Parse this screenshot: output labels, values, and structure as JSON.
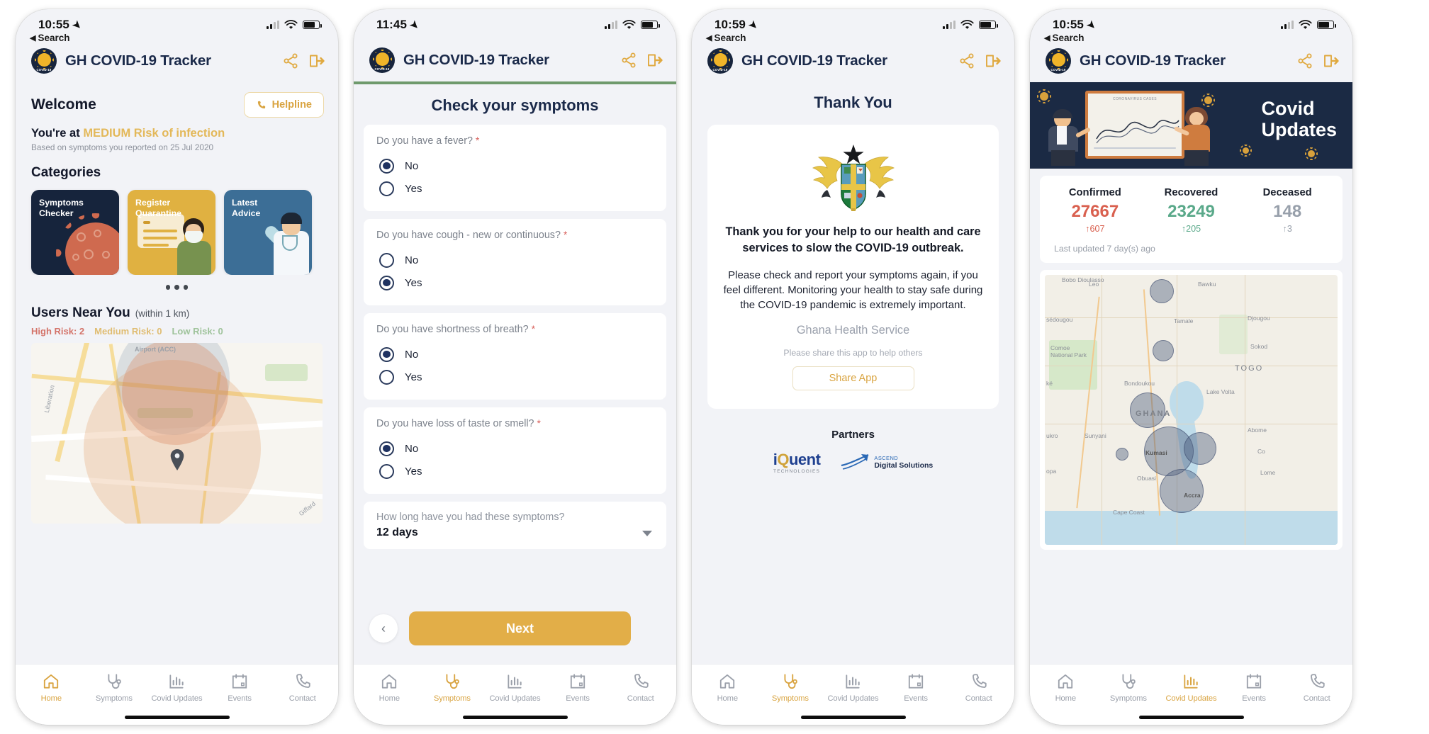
{
  "app": {
    "title": "GH COVID-19 Tracker",
    "back_label": "Search",
    "share_icon": "share-icon",
    "logout_icon": "logout-icon"
  },
  "nav": {
    "items": [
      {
        "label": "Home",
        "icon": "home-icon"
      },
      {
        "label": "Symptoms",
        "icon": "stethoscope-icon"
      },
      {
        "label": "Covid Updates",
        "icon": "bar-chart-icon"
      },
      {
        "label": "Events",
        "icon": "calendar-icon"
      },
      {
        "label": "Contact",
        "icon": "phone-icon"
      }
    ]
  },
  "phone1": {
    "status": {
      "time": "10:55",
      "battery": "78%"
    },
    "welcome_title": "Welcome",
    "helpline_label": "Helpline",
    "risk_prefix": "You're at",
    "risk_value": "MEDIUM Risk of infection",
    "risk_subtitle": "Based on symptoms you reported on 25 Jul 2020",
    "categories_title": "Categories",
    "cards": [
      {
        "line1": "Symptoms",
        "line2": "Checker",
        "theme": "dark"
      },
      {
        "line1": "Register",
        "line2": "Quarantine",
        "theme": "amber"
      },
      {
        "line1": "Latest",
        "line2": "Advice",
        "theme": "blue"
      }
    ],
    "users_title": "Users Near You",
    "users_radius": "(within 1 km)",
    "risk_counts": [
      {
        "label": "High Risk: 2",
        "color": "#d4746a"
      },
      {
        "label": "Medium Risk: 0",
        "color": "#e0bd72"
      },
      {
        "label": "Low Risk: 0",
        "color": "#9fc39b"
      }
    ],
    "map_labels": [
      "Liberation",
      "Airport (ACC)",
      "Giffard"
    ],
    "active_nav": "Home"
  },
  "phone2": {
    "status": {
      "time": "11:45"
    },
    "page_title": "Check your symptoms",
    "required_mark": "*",
    "questions": [
      {
        "text": "Do you have a fever?",
        "options": [
          "No",
          "Yes"
        ],
        "selected": "No"
      },
      {
        "text": "Do you have cough - new or continuous?",
        "options": [
          "No",
          "Yes"
        ],
        "selected": "Yes"
      },
      {
        "text": "Do you have shortness of breath?",
        "options": [
          "No",
          "Yes"
        ],
        "selected": "No"
      },
      {
        "text": "Do you have loss of taste or smell?",
        "options": [
          "No",
          "Yes"
        ],
        "selected": "No"
      }
    ],
    "duration": {
      "label": "How long have you had these symptoms?",
      "value": "12 days"
    },
    "back_label": "‹",
    "next_label": "Next",
    "active_nav": "Symptoms"
  },
  "phone3": {
    "status": {
      "time": "10:59"
    },
    "page_title": "Thank You",
    "emblem": "ghana-coat-of-arms",
    "message_bold": "Thank you for your help to our health and care services to slow the COVID-19 outbreak.",
    "message_body": "Please check and report your symptoms again, if you feel different. Monitoring your health to stay safe during the COVID-19 pandemic is extremely important.",
    "organisation": "Ghana Health Service",
    "share_note": "Please share this app to help others",
    "share_button": "Share App",
    "partners_title": "Partners",
    "partners": [
      {
        "name": "iQuent",
        "sub": "TECHNOLOGIES"
      },
      {
        "name": "ASCEND",
        "sub": "Digital Solutions"
      }
    ],
    "active_nav": "Symptoms"
  },
  "phone4": {
    "status": {
      "time": "10:55"
    },
    "banner_title_line1": "Covid",
    "banner_title_line2": "Updates",
    "banner_caption": "CORONAVIRUS CASES",
    "stats": [
      {
        "label": "Confirmed",
        "value": "27667",
        "delta": "↑607",
        "color": "#d9604f"
      },
      {
        "label": "Recovered",
        "value": "23249",
        "delta": "↑205",
        "color": "#5aa98a"
      },
      {
        "label": "Deceased",
        "value": "148",
        "delta": "↑3",
        "color": "#98a0ab"
      }
    ],
    "last_updated": "Last updated 7 day(s) ago",
    "map_labels": [
      "Leo",
      "Bawku",
      "Bobo Dioulasso",
      "sédougou",
      "Tamale",
      "Djougou",
      "Comoe National Park",
      "Sokod",
      "TOGO",
      "Bondoukou",
      "ké",
      "Lake Volta",
      "GHANA",
      "Sunyani",
      "Abome",
      "ukro",
      "Kumasi",
      "Co",
      "opa",
      "Obuasi",
      "Lome",
      "Accra",
      "Cape Coast"
    ],
    "active_nav": "Covid Updates"
  }
}
